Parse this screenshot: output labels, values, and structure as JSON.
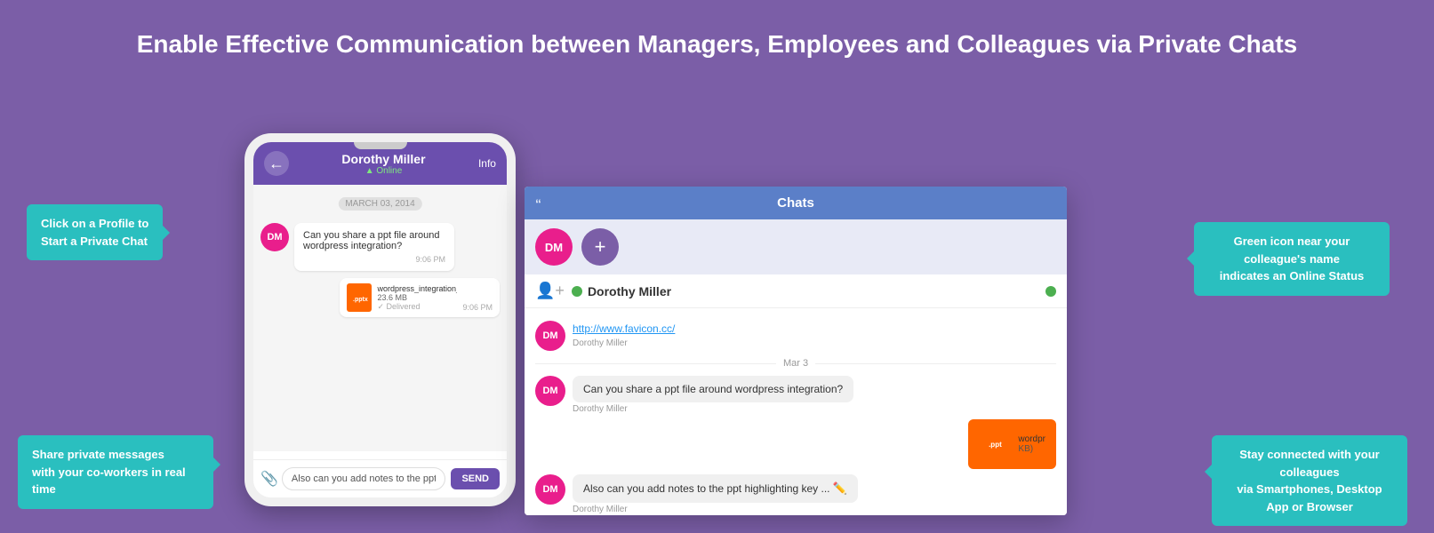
{
  "page": {
    "bg_color": "#7B5EA7",
    "heading": "Enable Effective Communication between Managers, Employees and Colleagues via Private Chats"
  },
  "tooltips": {
    "click_profile": {
      "line1": "Click on a Profile to",
      "line2": "Start a Private Chat"
    },
    "share_messages": {
      "line1": "Share private messages",
      "line2": "with your co-workers in real time"
    },
    "green_icon": {
      "line1": "Green icon near your colleague's name",
      "line2": "indicates an Online Status"
    },
    "stay_connected": {
      "line1": "Stay connected with your colleagues",
      "line2": "via Smartphones, Desktop App or Browser"
    }
  },
  "phone": {
    "contact_name": "Dorothy Miller",
    "status": "Online",
    "info_label": "Info",
    "date_label": "MARCH 03, 2014",
    "message1": "Can you share a ppt file around wordpress integration?",
    "message1_time": "9:06 PM",
    "file_name": "wordpress_integration_new.pptx",
    "file_size": "23.6 MB",
    "delivered_label": "Delivered",
    "file_time": "9:06 PM",
    "message2": "Also can you add notes to the ppt highlighting key",
    "send_label": "SEND",
    "avatar_initials": "DM"
  },
  "desktop": {
    "header_title": "Chats",
    "quote_icon": "“",
    "contact_name": "Dorothy Miller",
    "link_text": "http://www.favicon.cc/",
    "sender_label": "Dorothy Miller",
    "date_divider": "Mar 3",
    "message1": "Can you share a ppt file around wordpress integration?",
    "message2": "Also can you add notes to the ppt highlighting key ...",
    "file_name": "wordpr",
    "file_size_label": "KB)",
    "avatar_initials": "DM",
    "add_btn": "+",
    "ppt_label": ".ppt"
  }
}
